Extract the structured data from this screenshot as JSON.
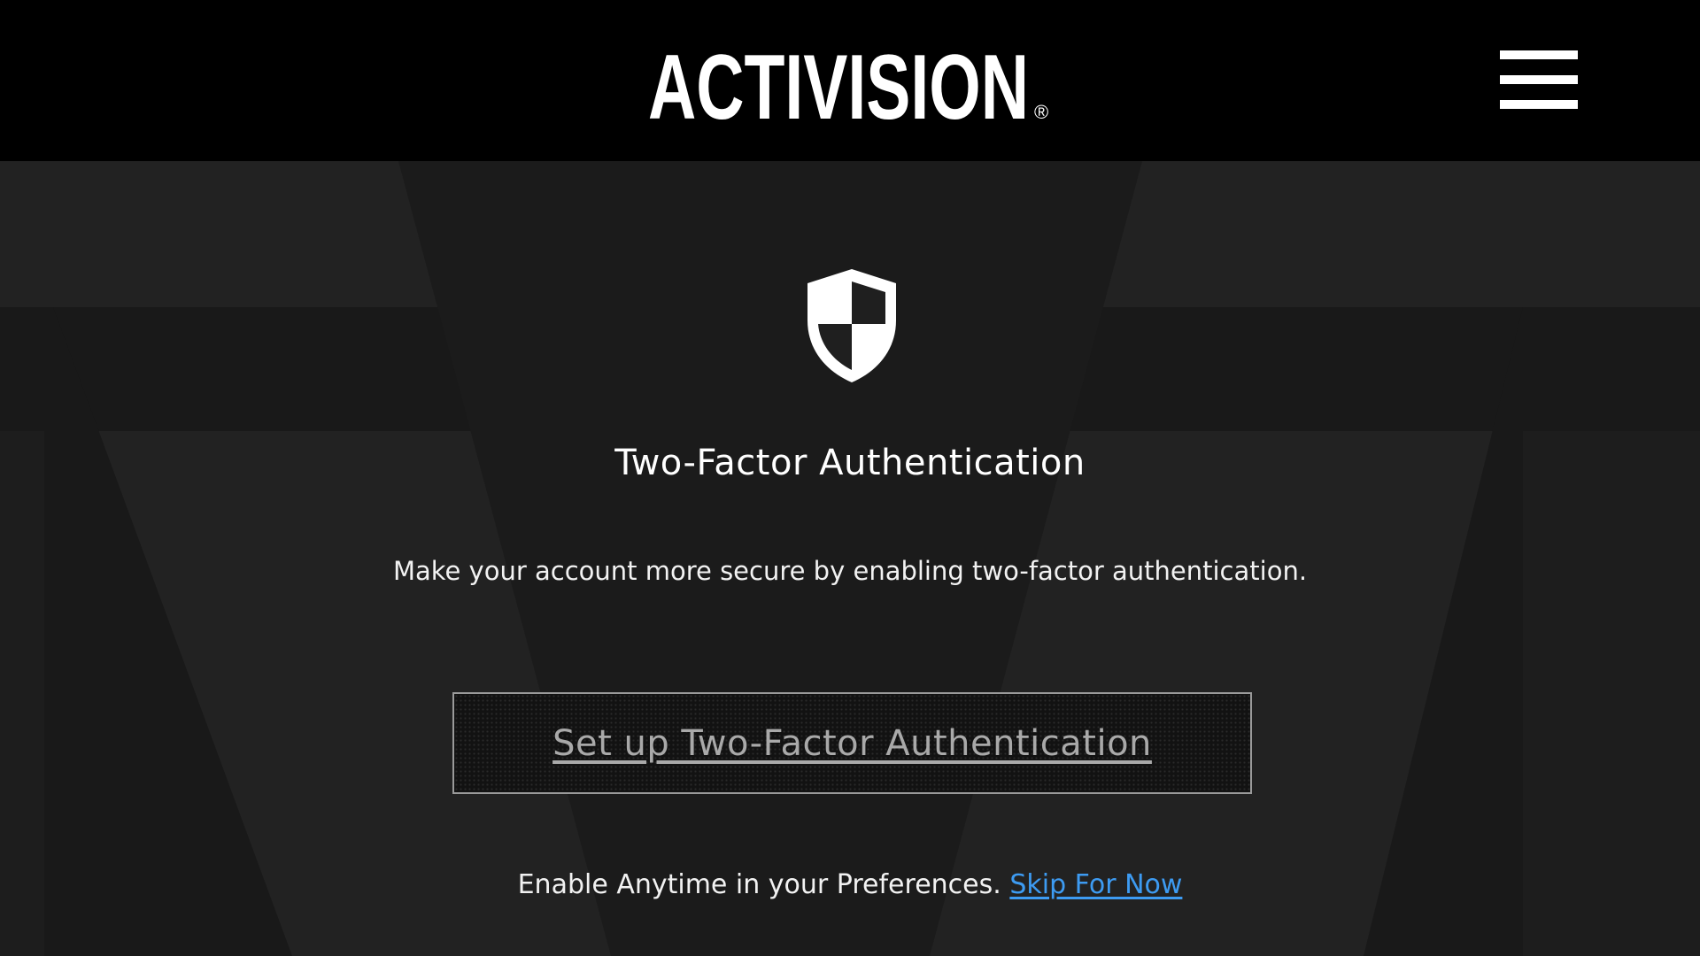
{
  "header": {
    "brand": "ACTIVISION",
    "registered_mark": "®",
    "menu_icon": "hamburger-menu-icon"
  },
  "main": {
    "icon": "shield-icon",
    "title": "Two-Factor Authentication",
    "description": "Make your account more secure by enabling two-factor authentication.",
    "setup_button_label": "Set up Two-Factor Authentication",
    "footer_text": "Enable Anytime in your Preferences.",
    "skip_link_label": "Skip For Now"
  },
  "colors": {
    "header_bg": "#000000",
    "page_bg": "#1f1f1f",
    "link": "#3d9bf2",
    "button_text": "#a9a9a9"
  }
}
